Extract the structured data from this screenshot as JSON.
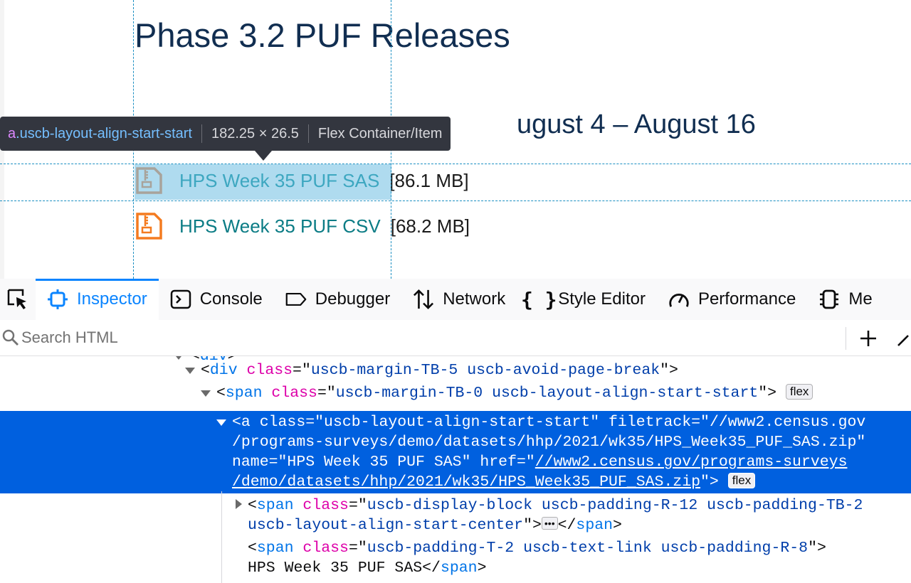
{
  "page": {
    "title": "Phase 3.2 PUF Releases",
    "section_heading_visible": "ugust 4 – August 16",
    "files": [
      {
        "name": "HPS Week 35 PUF SAS",
        "size": "[86.1 MB]"
      },
      {
        "name": "HPS Week 35 PUF CSV",
        "size": "[68.2 MB]"
      }
    ],
    "link_color": "#0b7c85",
    "icon_color": "#f47b20"
  },
  "infobar": {
    "tag": "a",
    "class": ".uscb-layout-align-start-start",
    "dimensions": "182.25 × 26.5",
    "type": "Flex Container/Item"
  },
  "devtools": {
    "tabs": [
      {
        "label": "Inspector",
        "icon": "inspector-icon",
        "active": true
      },
      {
        "label": "Console",
        "icon": "console-icon"
      },
      {
        "label": "Debugger",
        "icon": "debugger-icon"
      },
      {
        "label": "Network",
        "icon": "network-icon"
      },
      {
        "label": "Style Editor",
        "icon": "style-editor-icon"
      },
      {
        "label": "Performance",
        "icon": "performance-icon"
      },
      {
        "label": "Me",
        "icon": "memory-icon"
      }
    ],
    "search_placeholder": "Search HTML",
    "accent": "#0a84ff",
    "selection_color": "#0060df",
    "markup": {
      "line0_partial": "<div>",
      "div_tag": "div",
      "div_class": "uscb-margin-TB-5 uscb-avoid-page-break",
      "span_tag": "span",
      "span_class": "uscb-margin-TB-0 uscb-layout-align-start-start",
      "flex_badge": "flex",
      "a_tag": "a",
      "a_class": "uscb-layout-align-start-start",
      "a_filetrack_1": "//www2.census.gov",
      "a_filetrack_2": "/programs-surveys/demo/datasets/hhp/2021/wk35/HPS_Week35_PUF_SAS.zip",
      "a_name": "HPS Week 35 PUF SAS",
      "a_href_1": "//www2.census.gov/programs-surveys",
      "a_href_2": "/demo/datasets/hhp/2021/wk35/HPS_Week35_PUF_SAS.zip",
      "child1_class_1": "uscb-display-block uscb-padding-R-12 uscb-padding-TB-2",
      "child1_class_2": "uscb-layout-align-start-center",
      "ellipsis": "•••",
      "child2_class": "uscb-padding-T-2 uscb-text-link uscb-padding-R-8",
      "child2_text": "HPS Week 35 PUF SAS"
    }
  }
}
